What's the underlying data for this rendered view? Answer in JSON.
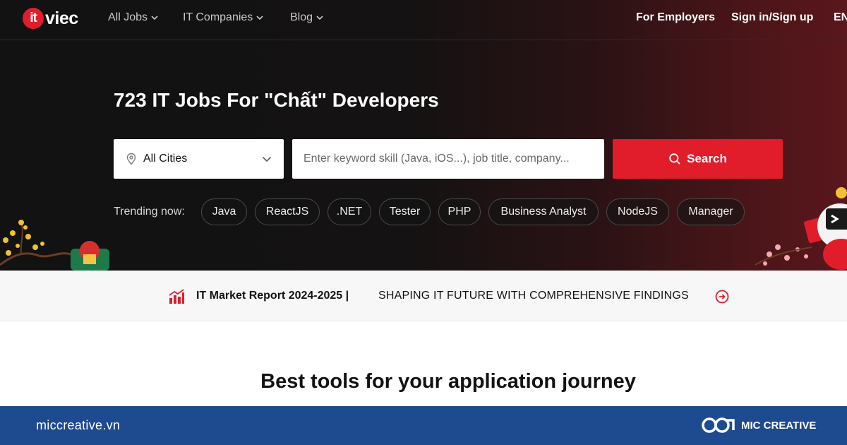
{
  "brand": {
    "logo_badge": "it",
    "logo_text": "viec",
    "accent_color": "#e11d2c"
  },
  "nav": {
    "items": [
      {
        "label": "All Jobs",
        "icon": "chevron-down-icon"
      },
      {
        "label": "IT Companies",
        "icon": "chevron-down-icon"
      },
      {
        "label": "Blog",
        "icon": "chevron-down-icon"
      }
    ],
    "for_employers": "For Employers",
    "sign_in": "Sign in/Sign up",
    "language": "EN"
  },
  "hero": {
    "title": "723 IT Jobs For \"Chất\" Developers"
  },
  "search": {
    "city_label": "All Cities",
    "city_icon": "map-pin-icon",
    "placeholder": "Enter keyword skill (Java, iOS...), job title, company...",
    "button_label": "Search",
    "button_icon": "search-icon"
  },
  "trending": {
    "label": "Trending now:",
    "tags": [
      "Java",
      "ReactJS",
      ".NET",
      "Tester",
      "PHP",
      "Business Analyst",
      "NodeJS",
      "Manager"
    ]
  },
  "report": {
    "icon": "bar-chart-icon",
    "title": "IT Market Report 2024-2025 |",
    "subtitle": "SHAPING IT FUTURE WITH COMPREHENSIVE FINDINGS",
    "arrow_icon": "arrow-right-circle-icon"
  },
  "section": {
    "title": "Best tools for your application journey"
  },
  "footer": {
    "url": "miccreative.vn",
    "brand": "MIC CREATIVE",
    "background": "#1e4a8f"
  }
}
